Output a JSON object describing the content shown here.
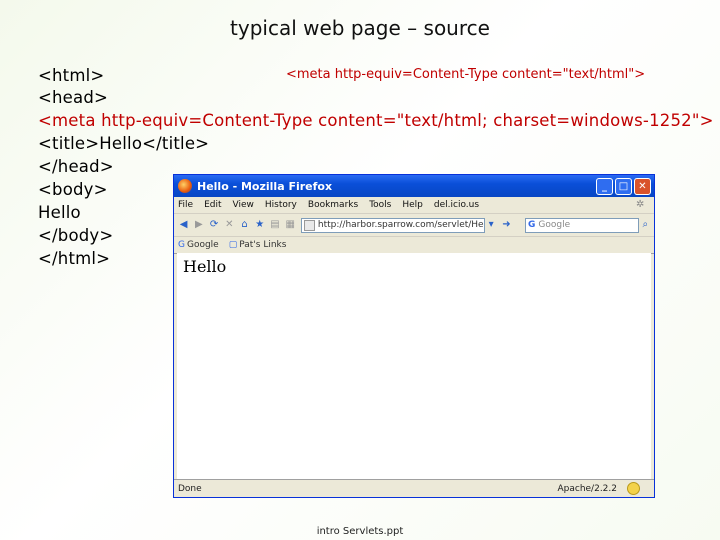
{
  "slide": {
    "title": "typical web page – source",
    "footer": "intro Servlets.ppt"
  },
  "code": {
    "line1": "<html>",
    "meta_small": "<meta http-equiv=Content-Type content=\"text/html\">",
    "line2": "<head>",
    "line3": "<meta http-equiv=Content-Type content=\"text/html; charset=windows-1252\">",
    "line4": "<title>Hello</title>",
    "line5": "</head>",
    "line6": "<body>",
    "line7": "Hello",
    "line8": "</body>",
    "line9": "</html>"
  },
  "browser": {
    "title": "Hello - Mozilla Firefox",
    "window_buttons": {
      "minimize": "_",
      "maximize": "□",
      "close": "✕"
    },
    "menu": [
      "File",
      "Edit",
      "View",
      "History",
      "Bookmarks",
      "Tools",
      "Help",
      "del.icio.us"
    ],
    "url": "http://harbor.sparrow.com/servlet/HelloServlet",
    "search_placeholder": "Google",
    "bookmarks": [
      "Google",
      "Pat's Links"
    ],
    "page_text": "Hello",
    "status_left": "Done",
    "status_right": "Apache/2.2.2"
  }
}
